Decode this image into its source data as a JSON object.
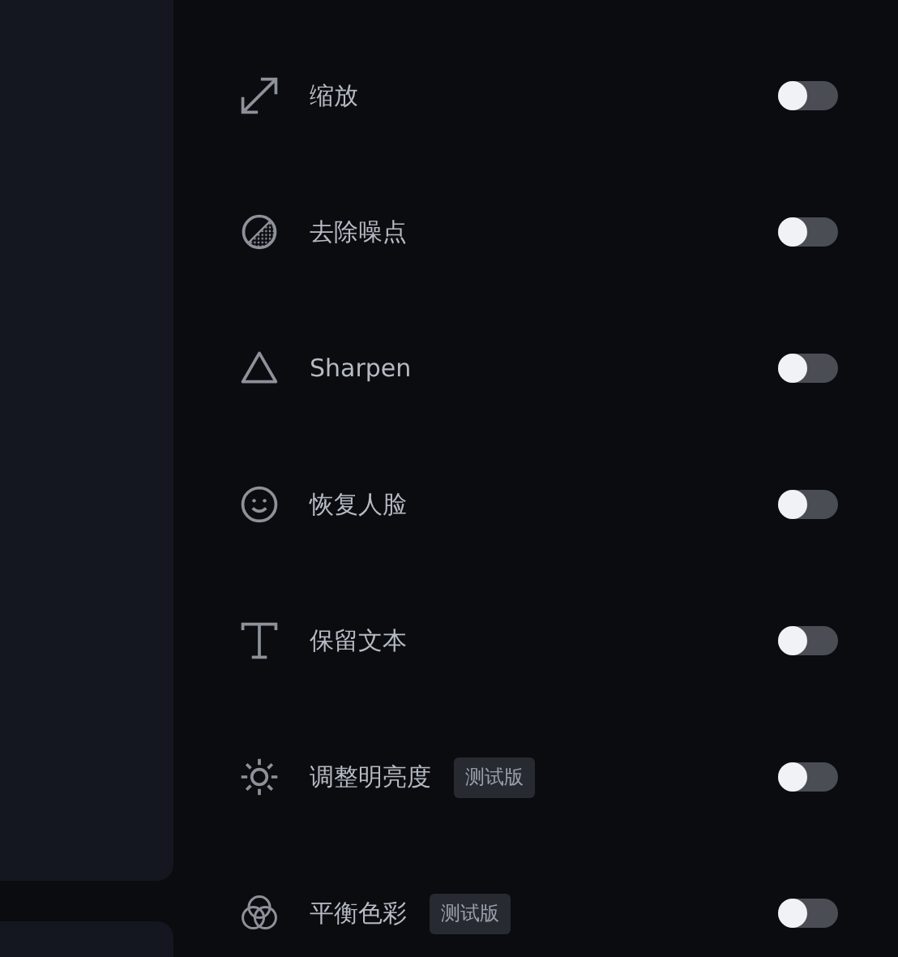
{
  "options": [
    {
      "kind": "scale",
      "label": "缩放",
      "on": false
    },
    {
      "kind": "denoise",
      "label": "去除噪点",
      "on": false
    },
    {
      "kind": "sharpen",
      "label": "Sharpen",
      "on": false
    },
    {
      "kind": "face",
      "label": "恢复人脸",
      "on": false
    },
    {
      "kind": "text",
      "label": "保留文本",
      "on": false
    },
    {
      "kind": "brightness",
      "label": "调整明亮度",
      "badge": "测试版",
      "on": false
    },
    {
      "kind": "color",
      "label": "平衡色彩",
      "badge": "测试版",
      "on": false
    }
  ]
}
